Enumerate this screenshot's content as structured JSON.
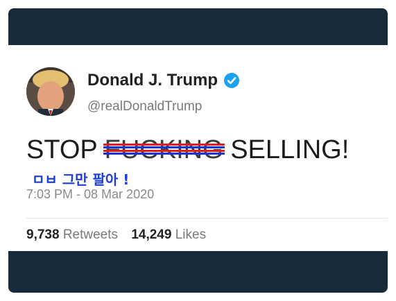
{
  "tweet": {
    "display_name": "Donald J. Trump",
    "handle": "@realDonaldTrump",
    "text_start": "STOP ",
    "text_struck": "FUCKING",
    "text_end": " SELLING!",
    "overlay": "ㅁㅂ 그만 팔아 !",
    "timestamp": "7:03 PM - 08 Mar 2020",
    "retweet_count": "9,738",
    "retweet_label": "Retweets",
    "like_count": "14,249",
    "like_label": "Likes"
  },
  "colors": {
    "frame": "#172a3a",
    "verified": "#1da1f2",
    "overlay_text": "#1b3fd6",
    "strike_red": "#e02020",
    "strike_blue": "#1e32d8"
  },
  "icons": [
    "avatar",
    "verified-badge-icon"
  ]
}
